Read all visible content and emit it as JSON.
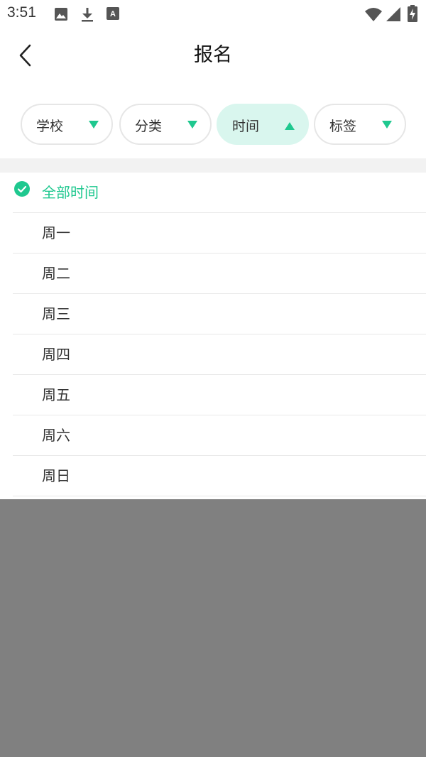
{
  "status_bar": {
    "time": "3:51",
    "left_icons": [
      "image-icon",
      "download-icon",
      "font-icon"
    ],
    "right_icons": [
      "wifi-icon",
      "cellular-icon",
      "battery-charging-icon"
    ]
  },
  "header": {
    "title": "报名",
    "back_icon": "chevron-left-icon"
  },
  "filters": [
    {
      "label": "学校",
      "state": "collapsed"
    },
    {
      "label": "分类",
      "state": "collapsed"
    },
    {
      "label": "时间",
      "state": "expanded"
    },
    {
      "label": "标签",
      "state": "collapsed"
    }
  ],
  "time_options": {
    "selected": "全部时间",
    "items": [
      "全部时间",
      "周一",
      "周二",
      "周三",
      "周四",
      "周五",
      "周六",
      "周日"
    ]
  },
  "colors": {
    "accent": "#1fc88f",
    "active_chip_bg": "#d9f6ee",
    "overlay": "#808080",
    "band": "#f2f2f2"
  }
}
